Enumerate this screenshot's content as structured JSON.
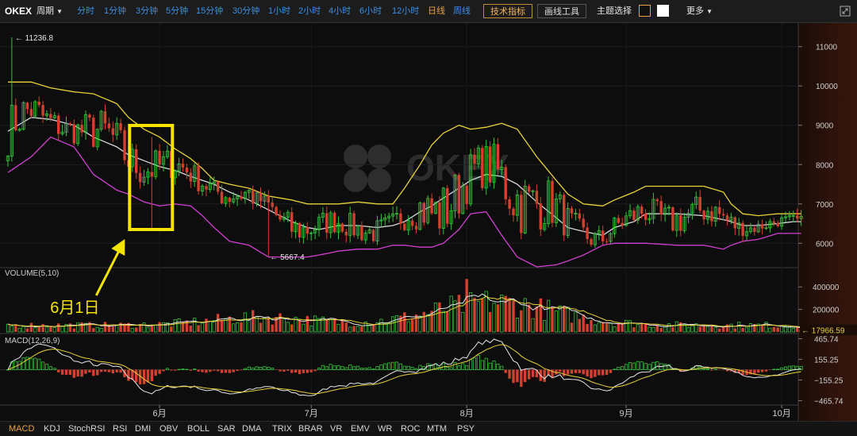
{
  "toolbar": {
    "brand": "OKEX",
    "period": "周期",
    "timeframes": [
      "分时",
      "1分钟",
      "3分钟",
      "5分钟",
      "15分钟",
      "30分钟",
      "1小时",
      "2小时",
      "4小时",
      "6小时",
      "12小时",
      "日线",
      "周线"
    ],
    "active_timeframe": "日线",
    "tech_indicator": "技术指标",
    "draw_tools": "画线工具",
    "theme_select": "主题选择",
    "more": "更多"
  },
  "watermark": "OKEX",
  "annotation": {
    "label": "6月1日",
    "color": "#f5e400"
  },
  "indicators": [
    "MACD",
    "KDJ",
    "StochRSI",
    "RSI",
    "DMI",
    "OBV",
    "BOLL",
    "SAR",
    "DMA",
    "TRIX",
    "BRAR",
    "VR",
    "EMV",
    "WR",
    "ROC",
    "MTM",
    "PSY"
  ],
  "active_indicator": "MACD",
  "colors": {
    "up": "#33c23a",
    "down": "#d4402f",
    "boll_upper": "#e8d239",
    "boll_mid": "#d8d8d8",
    "boll_lower": "#d23fd2",
    "accent": "#e8a33d"
  },
  "chart_data": {
    "type": "candlestick",
    "x_tick_labels": [
      {
        "label": "6月",
        "index": 39
      },
      {
        "label": "7月",
        "index": 78
      },
      {
        "label": "8月",
        "index": 118
      },
      {
        "label": "9月",
        "index": 159
      },
      {
        "label": "10月",
        "index": 199
      }
    ],
    "price_panel": {
      "y_ticks": [
        6000,
        7000,
        8000,
        9000,
        10000,
        11000
      ],
      "ylim": [
        5400,
        11600
      ],
      "max_label": "11236.8",
      "min_label": "5667.4",
      "max_price": 11236.8,
      "min_price": 5667.4,
      "max_index": 1,
      "min_index": 67,
      "annotated_index": 37,
      "bollinger": {
        "upper": [
          [
            0,
            10100
          ],
          [
            6,
            10100
          ],
          [
            11,
            9950
          ],
          [
            17,
            9850
          ],
          [
            22,
            9800
          ],
          [
            28,
            9550
          ],
          [
            31,
            9200
          ],
          [
            35,
            8900
          ],
          [
            39,
            8700
          ],
          [
            43,
            8400
          ],
          [
            47,
            8150
          ],
          [
            50,
            7900
          ],
          [
            53,
            7600
          ],
          [
            57,
            7500
          ],
          [
            62,
            7400
          ],
          [
            67,
            7200
          ],
          [
            73,
            7100
          ],
          [
            77,
            7000
          ],
          [
            80,
            7000
          ],
          [
            85,
            7000
          ],
          [
            90,
            7050
          ],
          [
            95,
            7000
          ],
          [
            99,
            7000
          ],
          [
            102,
            7400
          ],
          [
            106,
            8000
          ],
          [
            109,
            8500
          ],
          [
            112,
            8800
          ],
          [
            116,
            9000
          ],
          [
            119,
            8900
          ],
          [
            123,
            8950
          ],
          [
            127,
            9050
          ],
          [
            131,
            8900
          ],
          [
            136,
            8200
          ],
          [
            141,
            7600
          ],
          [
            144,
            7250
          ],
          [
            148,
            7000
          ],
          [
            153,
            6950
          ],
          [
            156,
            7100
          ],
          [
            161,
            7300
          ],
          [
            164,
            7450
          ],
          [
            172,
            7450
          ],
          [
            179,
            7450
          ],
          [
            184,
            7300
          ],
          [
            186,
            7000
          ],
          [
            189,
            6750
          ],
          [
            193,
            6700
          ],
          [
            198,
            6750
          ],
          [
            202,
            6750
          ]
        ],
        "mid": [
          [
            0,
            8850
          ],
          [
            6,
            9200
          ],
          [
            11,
            9150
          ],
          [
            17,
            9000
          ],
          [
            22,
            8700
          ],
          [
            28,
            8450
          ],
          [
            31,
            8250
          ],
          [
            35,
            8100
          ],
          [
            39,
            7950
          ],
          [
            43,
            7850
          ],
          [
            47,
            7700
          ],
          [
            50,
            7600
          ],
          [
            53,
            7500
          ],
          [
            57,
            7300
          ],
          [
            62,
            7100
          ],
          [
            67,
            6850
          ],
          [
            73,
            6550
          ],
          [
            77,
            6400
          ],
          [
            80,
            6350
          ],
          [
            85,
            6450
          ],
          [
            90,
            6450
          ],
          [
            95,
            6400
          ],
          [
            99,
            6450
          ],
          [
            102,
            6550
          ],
          [
            106,
            6800
          ],
          [
            109,
            6950
          ],
          [
            112,
            7150
          ],
          [
            116,
            7400
          ],
          [
            119,
            7600
          ],
          [
            123,
            7750
          ],
          [
            127,
            7700
          ],
          [
            131,
            7500
          ],
          [
            136,
            7050
          ],
          [
            141,
            6650
          ],
          [
            144,
            6400
          ],
          [
            148,
            6300
          ],
          [
            153,
            6200
          ],
          [
            156,
            6400
          ],
          [
            161,
            6550
          ],
          [
            164,
            6750
          ],
          [
            172,
            6750
          ],
          [
            179,
            6700
          ],
          [
            184,
            6600
          ],
          [
            186,
            6550
          ],
          [
            189,
            6450
          ],
          [
            193,
            6450
          ],
          [
            198,
            6500
          ],
          [
            202,
            6550
          ]
        ],
        "lower": [
          [
            0,
            7800
          ],
          [
            6,
            8200
          ],
          [
            11,
            8700
          ],
          [
            17,
            8450
          ],
          [
            22,
            7750
          ],
          [
            28,
            7350
          ],
          [
            31,
            7250
          ],
          [
            35,
            7050
          ],
          [
            39,
            6950
          ],
          [
            43,
            7000
          ],
          [
            47,
            6950
          ],
          [
            50,
            6700
          ],
          [
            53,
            6400
          ],
          [
            57,
            6050
          ],
          [
            62,
            5950
          ],
          [
            67,
            5650
          ],
          [
            73,
            5650
          ],
          [
            77,
            5650
          ],
          [
            80,
            5700
          ],
          [
            85,
            5800
          ],
          [
            90,
            5850
          ],
          [
            95,
            5850
          ],
          [
            99,
            5950
          ],
          [
            102,
            5950
          ],
          [
            106,
            5900
          ],
          [
            109,
            5900
          ],
          [
            112,
            6000
          ],
          [
            116,
            6350
          ],
          [
            119,
            6750
          ],
          [
            123,
            6800
          ],
          [
            127,
            6200
          ],
          [
            131,
            5650
          ],
          [
            136,
            5400
          ],
          [
            141,
            5450
          ],
          [
            144,
            5550
          ],
          [
            148,
            5700
          ],
          [
            153,
            5950
          ],
          [
            156,
            6000
          ],
          [
            161,
            6000
          ],
          [
            164,
            6000
          ],
          [
            172,
            5950
          ],
          [
            179,
            5950
          ],
          [
            184,
            5850
          ],
          [
            186,
            5950
          ],
          [
            189,
            6050
          ],
          [
            193,
            6100
          ],
          [
            198,
            6250
          ],
          [
            202,
            6250
          ]
        ]
      }
    },
    "volume_panel": {
      "title": "VOLUME(5,10)",
      "y_ticks": [
        200000,
        400000
      ],
      "ylim": [
        0,
        500000
      ],
      "last_label": "17966.59",
      "last_value": 17966.59
    },
    "macd_panel": {
      "title": "MACD(12,26,9)",
      "y_ticks": [
        465.74,
        155.25,
        -155.25,
        -465.74
      ],
      "y_tick_labels": [
        "465.74",
        "155.25",
        "−155.25",
        "−465.74"
      ],
      "ylim": [
        -520,
        520
      ]
    }
  }
}
